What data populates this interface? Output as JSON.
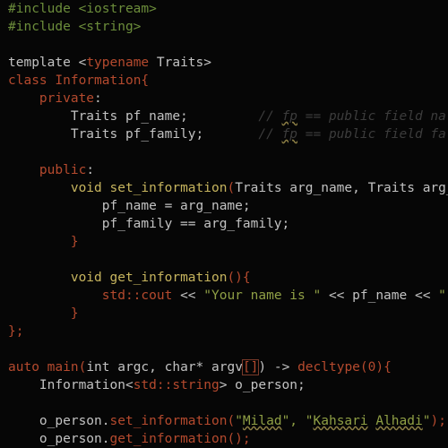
{
  "editor": {
    "background": "#060606",
    "colors": {
      "preprocessor": "#6c8d3b",
      "keyword": "#c2c2c2",
      "highlight_red": "#b54a2e",
      "function_olive": "#c6b45e",
      "string_green": "#8f9f45",
      "comment_gray": "#3c3c3c"
    },
    "lines": [
      {
        "tokens": [
          {
            "t": "#include <iostream>",
            "c": "pre"
          }
        ]
      },
      {
        "tokens": [
          {
            "t": "#include <string>",
            "c": "pre"
          }
        ]
      },
      {
        "tokens": []
      },
      {
        "tokens": [
          {
            "t": "template <",
            "c": "kw"
          },
          {
            "t": "typename",
            "c": "red"
          },
          {
            "t": " Traits>",
            "c": "kw"
          }
        ]
      },
      {
        "tokens": [
          {
            "t": "class ",
            "c": "red"
          },
          {
            "t": "Information",
            "c": "red"
          },
          {
            "t": "{",
            "c": "red"
          }
        ]
      },
      {
        "tokens": [
          {
            "t": "    private",
            "c": "red"
          },
          {
            "t": ":",
            "c": "plain"
          }
        ]
      },
      {
        "tokens": [
          {
            "t": "        Traits pf_name;",
            "c": "plain"
          },
          {
            "t": "         // ",
            "c": "cmt"
          },
          {
            "t": "fp",
            "c": "cmt",
            "ul": true
          },
          {
            "t": " == public field na",
            "c": "cmt"
          }
        ]
      },
      {
        "tokens": [
          {
            "t": "        Traits pf_family;",
            "c": "plain"
          },
          {
            "t": "       // ",
            "c": "cmt"
          },
          {
            "t": "fp",
            "c": "cmt",
            "ul": true
          },
          {
            "t": " == public field fa",
            "c": "cmt"
          }
        ]
      },
      {
        "tokens": []
      },
      {
        "tokens": [
          {
            "t": "    public",
            "c": "red"
          },
          {
            "t": ":",
            "c": "plain"
          }
        ]
      },
      {
        "tokens": [
          {
            "t": "        ",
            "c": "plain"
          },
          {
            "t": "void",
            "c": "olive"
          },
          {
            "t": " set_information",
            "c": "olive"
          },
          {
            "t": "(",
            "c": "red"
          },
          {
            "t": "Traits arg_name, Traits arg_",
            "c": "plain"
          }
        ]
      },
      {
        "tokens": [
          {
            "t": "            pf_name = arg_name;",
            "c": "plain"
          }
        ]
      },
      {
        "tokens": [
          {
            "t": "            pf_family == arg_family;",
            "c": "plain"
          }
        ]
      },
      {
        "tokens": [
          {
            "t": "        }",
            "c": "red"
          }
        ]
      },
      {
        "tokens": []
      },
      {
        "tokens": [
          {
            "t": "        ",
            "c": "plain"
          },
          {
            "t": "void",
            "c": "olive"
          },
          {
            "t": " get_information",
            "c": "olive"
          },
          {
            "t": "(){",
            "c": "red"
          }
        ]
      },
      {
        "tokens": [
          {
            "t": "            ",
            "c": "plain"
          },
          {
            "t": "std::cout",
            "c": "red"
          },
          {
            "t": " << ",
            "c": "plain"
          },
          {
            "t": "\"Your name is \"",
            "c": "str"
          },
          {
            "t": " << pf_name << ",
            "c": "plain"
          },
          {
            "t": "\"",
            "c": "str"
          }
        ]
      },
      {
        "tokens": [
          {
            "t": "        }",
            "c": "red"
          }
        ]
      },
      {
        "tokens": [
          {
            "t": "};",
            "c": "red"
          }
        ]
      },
      {
        "tokens": []
      },
      {
        "tokens": [
          {
            "t": "auto ",
            "c": "red"
          },
          {
            "t": "main",
            "c": "red"
          },
          {
            "t": "(",
            "c": "red"
          },
          {
            "t": "int argc, ",
            "c": "plain"
          },
          {
            "t": "char",
            "c": "plain"
          },
          {
            "t": "* argv",
            "c": "plain"
          },
          {
            "t": "[]",
            "c": "red",
            "box": true
          },
          {
            "t": ") -> ",
            "c": "plain"
          },
          {
            "t": "decltype",
            "c": "red"
          },
          {
            "t": "(0){",
            "c": "red"
          }
        ]
      },
      {
        "tokens": [
          {
            "t": "    Information<",
            "c": "plain"
          },
          {
            "t": "std::string",
            "c": "red"
          },
          {
            "t": "> o_person;",
            "c": "plain"
          }
        ]
      },
      {
        "tokens": []
      },
      {
        "tokens": [
          {
            "t": "    o_person.",
            "c": "plain"
          },
          {
            "t": "set_information",
            "c": "red"
          },
          {
            "t": "(",
            "c": "red"
          },
          {
            "t": "\"",
            "c": "str"
          },
          {
            "t": "Milad",
            "c": "str",
            "ul": true
          },
          {
            "t": "\", \"",
            "c": "str"
          },
          {
            "t": "Kahsari",
            "c": "str",
            "ul": true
          },
          {
            "t": " ",
            "c": "str"
          },
          {
            "t": "Alhadi",
            "c": "str",
            "ul": true
          },
          {
            "t": "\"",
            "c": "str"
          },
          {
            "t": ");",
            "c": "red"
          }
        ]
      },
      {
        "tokens": [
          {
            "t": "    o_person.",
            "c": "plain"
          },
          {
            "t": "get_information",
            "c": "red"
          },
          {
            "t": "();",
            "c": "red"
          }
        ]
      }
    ]
  }
}
